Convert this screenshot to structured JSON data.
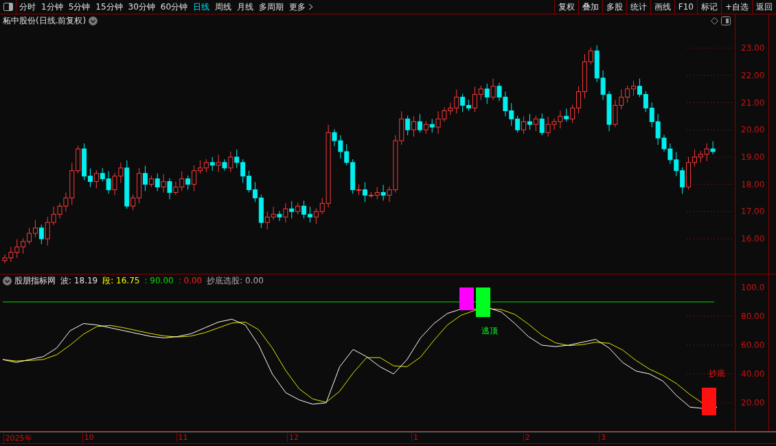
{
  "toolbar": {
    "periods": [
      {
        "label": "分时",
        "selected": false
      },
      {
        "label": "1分钟",
        "selected": false
      },
      {
        "label": "5分钟",
        "selected": false
      },
      {
        "label": "15分钟",
        "selected": false
      },
      {
        "label": "30分钟",
        "selected": false
      },
      {
        "label": "60分钟",
        "selected": false
      },
      {
        "label": "日线",
        "selected": true
      },
      {
        "label": "周线",
        "selected": false
      },
      {
        "label": "月线",
        "selected": false
      },
      {
        "label": "多周期",
        "selected": false
      },
      {
        "label": "更多",
        "selected": false
      }
    ],
    "buttons": [
      "复权",
      "叠加",
      "多股",
      "统计",
      "画线",
      "F10",
      "标记",
      "+自选",
      "返回"
    ]
  },
  "price_panel": {
    "title": "柘中股份(日线.前复权)",
    "yticks": [
      "23.00",
      "22.00",
      "21.00",
      "20.00",
      "19.00",
      "18.00",
      "17.00",
      "16.00"
    ]
  },
  "indicator_panel": {
    "name": "股朋指标网",
    "values": [
      {
        "text": "波: 18.19",
        "color": "#e0e0e0"
      },
      {
        "text": "段: 16.75",
        "color": "#ffff00"
      },
      {
        "text": ": 90.00",
        "color": "#00e000"
      },
      {
        "text": ": 0.00",
        "color": "#ff2020"
      },
      {
        "text": "抄底选股: 0.00",
        "color": "#b0b0b0"
      }
    ],
    "yticks": [
      "100.0",
      "80.00",
      "60.00",
      "40.00",
      "20.00"
    ],
    "signals": [
      {
        "label": "逃顶",
        "kind": "top",
        "color": "#00ff20"
      },
      {
        "label": "抄底",
        "kind": "bottom",
        "color": "#ff1010"
      }
    ]
  },
  "time_axis": [
    "2025年",
    "10",
    "11",
    "12",
    "1",
    "2",
    "3"
  ]
}
